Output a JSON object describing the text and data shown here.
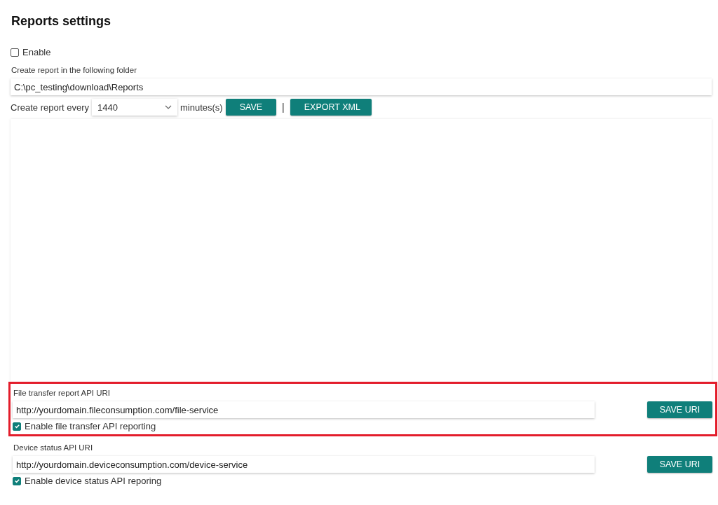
{
  "title": "Reports settings",
  "enable": {
    "label": "Enable",
    "checked": false
  },
  "folder": {
    "label": "Create report in the following folder",
    "value": "C:\\pc_testing\\download\\Reports"
  },
  "schedule": {
    "label": "Create report every",
    "value": "1440",
    "unit": "minutes(s)",
    "buttons": [
      "SAVE",
      "EXPORT XML"
    ],
    "separator": "|"
  },
  "api_sections": [
    {
      "label": "File transfer report API URI",
      "value": "http://yourdomain.fileconsumption.com/file-service",
      "button": "SAVE URI",
      "checkbox_label": "Enable file transfer API reporting",
      "checked": true,
      "highlighted": true
    },
    {
      "label": "Device status API URI",
      "value": "http://yourdomain.deviceconsumption.com/device-service",
      "button": "SAVE URI",
      "checkbox_label": "Enable device status API reporing",
      "checked": true,
      "highlighted": false
    }
  ]
}
